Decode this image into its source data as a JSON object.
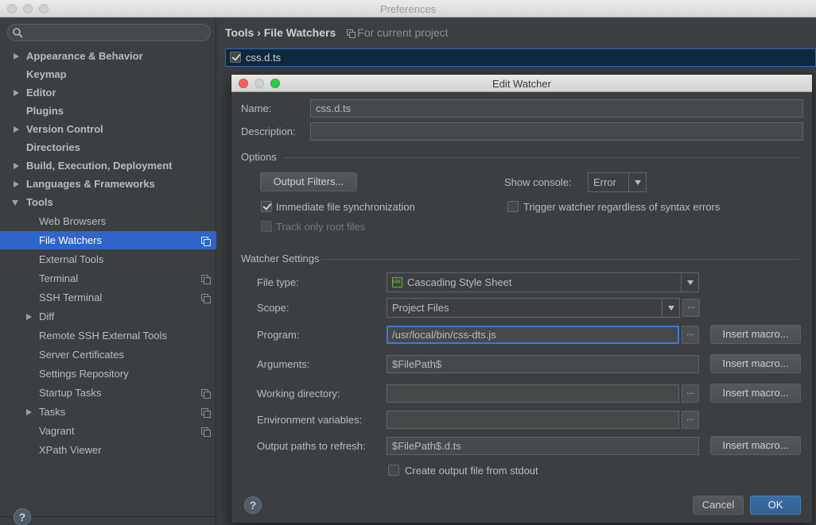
{
  "window": {
    "title": "Preferences"
  },
  "search": {
    "placeholder": ""
  },
  "sidebar": {
    "items": [
      {
        "label": "Appearance & Behavior"
      },
      {
        "label": "Keymap"
      },
      {
        "label": "Editor"
      },
      {
        "label": "Plugins"
      },
      {
        "label": "Version Control"
      },
      {
        "label": "Directories"
      },
      {
        "label": "Build, Execution, Deployment"
      },
      {
        "label": "Languages & Frameworks"
      },
      {
        "label": "Tools"
      },
      {
        "label": "Web Browsers"
      },
      {
        "label": "File Watchers"
      },
      {
        "label": "External Tools"
      },
      {
        "label": "Terminal"
      },
      {
        "label": "SSH Terminal"
      },
      {
        "label": "Diff"
      },
      {
        "label": "Remote SSH External Tools"
      },
      {
        "label": "Server Certificates"
      },
      {
        "label": "Settings Repository"
      },
      {
        "label": "Startup Tasks"
      },
      {
        "label": "Tasks"
      },
      {
        "label": "Vagrant"
      },
      {
        "label": "XPath Viewer"
      }
    ]
  },
  "main": {
    "breadcrumb_parent": "Tools",
    "breadcrumb_sep": "›",
    "breadcrumb_current": "File Watchers",
    "scope_note": "For current project",
    "watchers": [
      {
        "name": "css.d.ts",
        "enabled": true
      }
    ]
  },
  "help": {
    "symbol": "?"
  },
  "dialog": {
    "title": "Edit Watcher",
    "name_label": "Name:",
    "name_value": "css.d.ts",
    "description_label": "Description:",
    "description_value": "",
    "options_header": "Options",
    "output_filters_button": "Output Filters...",
    "show_console_label": "Show console:",
    "show_console_value": "Error",
    "immediate_sync_label": "Immediate file synchronization",
    "immediate_sync_checked": true,
    "trigger_label": "Trigger watcher regardless of syntax errors",
    "trigger_checked": false,
    "track_root_label": "Track only root files",
    "track_root_checked": false,
    "watcher_settings_header": "Watcher Settings",
    "file_type_label": "File type:",
    "file_type_value": "Cascading Style Sheet",
    "scope_label": "Scope:",
    "scope_value": "Project Files",
    "program_label": "Program:",
    "program_value": "/usr/local/bin/css-dts.js",
    "arguments_label": "Arguments:",
    "arguments_value": "$FilePath$",
    "working_dir_label": "Working directory:",
    "working_dir_value": "",
    "env_vars_label": "Environment variables:",
    "env_vars_value": "",
    "output_paths_label": "Output paths to refresh:",
    "output_paths_value": "$FilePath$.d.ts",
    "create_output_label": "Create output file from stdout",
    "create_output_checked": false,
    "insert_macro_button": "Insert macro...",
    "browse_button": "...",
    "cancel_button": "Cancel",
    "ok_button": "OK"
  }
}
